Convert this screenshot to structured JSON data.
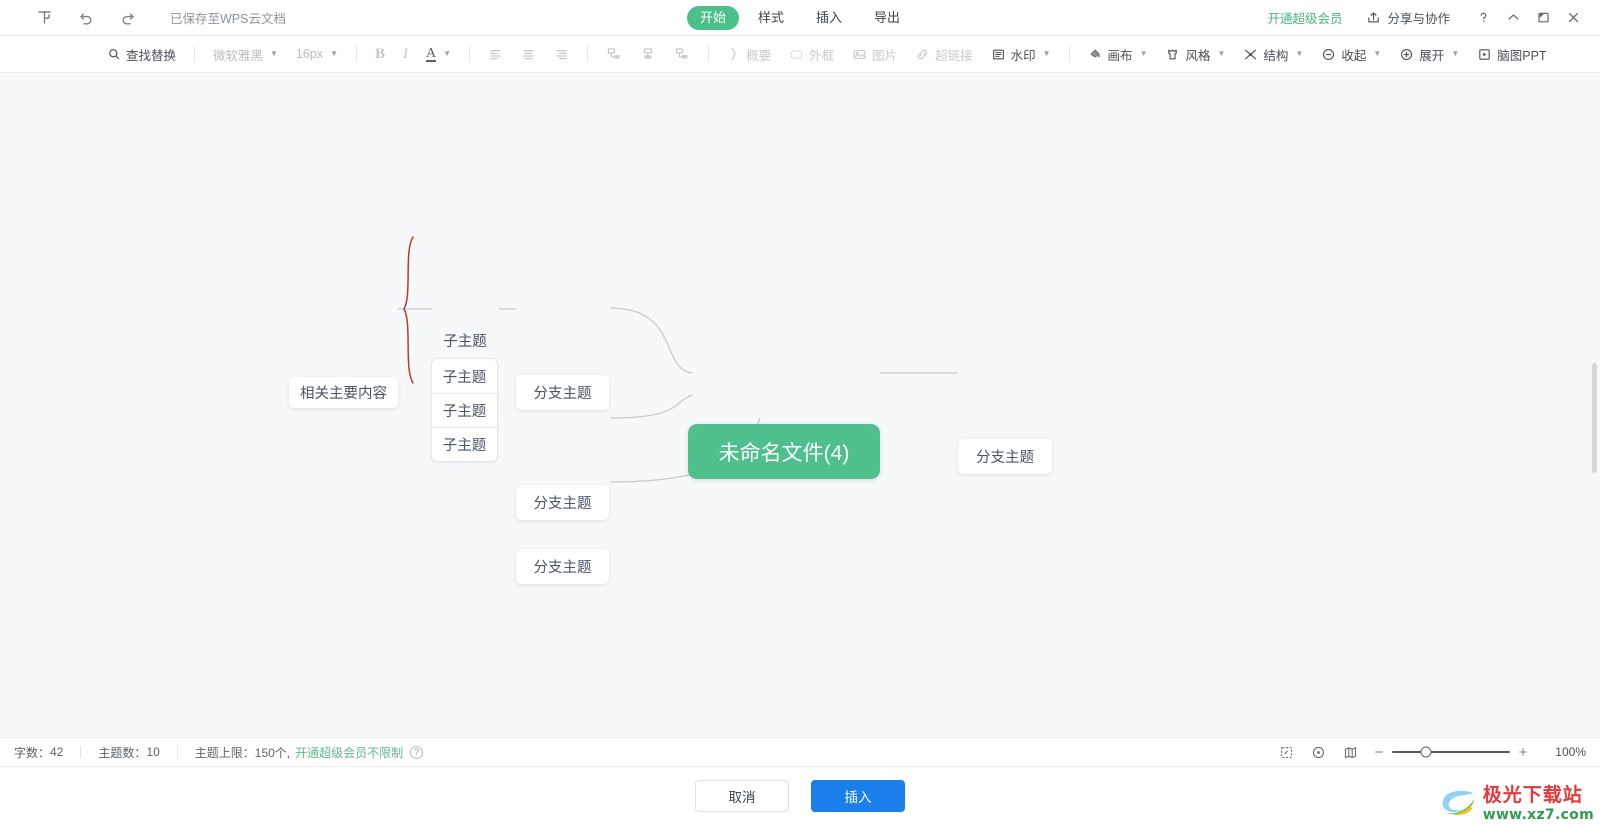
{
  "titlebar": {
    "logo_icon": "wps-mindmap-logo-icon",
    "undo_icon": "undo-icon",
    "redo_icon": "redo-icon",
    "save_status": "已保存至WPS云文档",
    "tabs": [
      {
        "label": "开始",
        "active": true
      },
      {
        "label": "样式",
        "active": false
      },
      {
        "label": "插入",
        "active": false
      },
      {
        "label": "导出",
        "active": false
      }
    ],
    "vip_label": "开通超级会员",
    "share_label": "分享与协作",
    "share_icon": "share-icon",
    "help_icon": "question-mark-icon",
    "minimize_icon": "minimize-icon",
    "restore_icon": "restore-window-icon",
    "close_icon": "close-icon"
  },
  "toolbar": {
    "find_replace": "查找替换",
    "font_family": "微软雅黑",
    "font_size": "16px",
    "bold": "B",
    "italic": "I",
    "font_color": "A",
    "align_left": "align-left-icon",
    "align_center": "align-center-icon",
    "align_right": "align-right-icon",
    "layout_1": "topic-layout-right-icon",
    "layout_2": "topic-layout-down-icon",
    "layout_3": "topic-layout-left-icon",
    "summary": "概要",
    "outline_frame": "外框",
    "image": "图片",
    "hyperlink": "超链接",
    "watermark": "水印",
    "canvas": "画布",
    "style": "风格",
    "structure": "结构",
    "collapse": "收起",
    "expand": "展开",
    "mind_ppt": "脑图PPT"
  },
  "map": {
    "root": {
      "label": "未命名文件(4)",
      "color": "#4fc08d"
    },
    "left_branches": [
      {
        "label": "分支主题"
      },
      {
        "label": "分支主题"
      },
      {
        "label": "分支主题"
      }
    ],
    "right_branches": [
      {
        "label": "分支主题"
      }
    ],
    "related_node": {
      "label": "相关主要内容"
    },
    "brace_color": "#c0392b",
    "sub_topic_top": "子主题",
    "sub_topics": [
      {
        "label": "子主题"
      },
      {
        "label": "子主题"
      },
      {
        "label": "子主题"
      }
    ]
  },
  "statusbar": {
    "word_count_label": "字数：",
    "word_count_value": "42",
    "topic_count_label": "主题数：",
    "topic_count_value": "10",
    "topic_limit_label": "主题上限：",
    "topic_limit_value": "150个,",
    "topic_limit_link": "开通超级会员不限制",
    "help_icon_char": "?",
    "fit_icon": "fit-screen-icon",
    "center_icon": "center-view-icon",
    "mini_map_icon": "mini-map-icon",
    "zoom_out": "−",
    "zoom_in": "+",
    "zoom_value": "100%"
  },
  "footer": {
    "cancel_label": "取消",
    "insert_label": "插入",
    "watermark_top": "极光下载站",
    "watermark_bottom": "www.xz7.com"
  }
}
